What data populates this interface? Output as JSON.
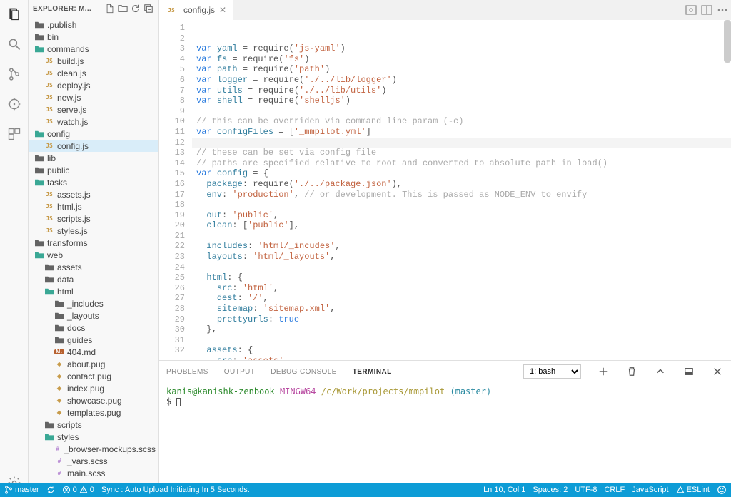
{
  "sidebar": {
    "title": "EXPLORER: M...",
    "tree": [
      {
        "label": ".publish",
        "type": "folder",
        "indent": 0,
        "clr": "grey"
      },
      {
        "label": "bin",
        "type": "folder",
        "indent": 0,
        "clr": "grey"
      },
      {
        "label": "commands",
        "type": "folder",
        "indent": 0,
        "clr": "teal"
      },
      {
        "label": "build.js",
        "type": "js",
        "indent": 1
      },
      {
        "label": "clean.js",
        "type": "js",
        "indent": 1
      },
      {
        "label": "deploy.js",
        "type": "js",
        "indent": 1
      },
      {
        "label": "new.js",
        "type": "js",
        "indent": 1
      },
      {
        "label": "serve.js",
        "type": "js",
        "indent": 1
      },
      {
        "label": "watch.js",
        "type": "js",
        "indent": 1
      },
      {
        "label": "config",
        "type": "folder",
        "indent": 0,
        "clr": "teal"
      },
      {
        "label": "config.js",
        "type": "js",
        "indent": 1,
        "selected": true
      },
      {
        "label": "lib",
        "type": "folder",
        "indent": 0,
        "clr": "grey"
      },
      {
        "label": "public",
        "type": "folder",
        "indent": 0,
        "clr": "grey"
      },
      {
        "label": "tasks",
        "type": "folder",
        "indent": 0,
        "clr": "teal"
      },
      {
        "label": "assets.js",
        "type": "js",
        "indent": 1
      },
      {
        "label": "html.js",
        "type": "js",
        "indent": 1
      },
      {
        "label": "scripts.js",
        "type": "js",
        "indent": 1
      },
      {
        "label": "styles.js",
        "type": "js",
        "indent": 1
      },
      {
        "label": "transforms",
        "type": "folder",
        "indent": 0,
        "clr": "grey"
      },
      {
        "label": "web",
        "type": "folder",
        "indent": 0,
        "clr": "teal"
      },
      {
        "label": "assets",
        "type": "folder",
        "indent": 1,
        "clr": "grey"
      },
      {
        "label": "data",
        "type": "folder",
        "indent": 1,
        "clr": "grey"
      },
      {
        "label": "html",
        "type": "folder",
        "indent": 1,
        "clr": "teal"
      },
      {
        "label": "_includes",
        "type": "folder",
        "indent": 2,
        "clr": "grey"
      },
      {
        "label": "_layouts",
        "type": "folder",
        "indent": 2,
        "clr": "grey"
      },
      {
        "label": "docs",
        "type": "folder",
        "indent": 2,
        "clr": "grey"
      },
      {
        "label": "guides",
        "type": "folder",
        "indent": 2,
        "clr": "grey"
      },
      {
        "label": "404.md",
        "type": "md",
        "indent": 2
      },
      {
        "label": "about.pug",
        "type": "pug",
        "indent": 2
      },
      {
        "label": "contact.pug",
        "type": "pug",
        "indent": 2
      },
      {
        "label": "index.pug",
        "type": "pug",
        "indent": 2
      },
      {
        "label": "showcase.pug",
        "type": "pug",
        "indent": 2
      },
      {
        "label": "templates.pug",
        "type": "pug",
        "indent": 2
      },
      {
        "label": "scripts",
        "type": "folder",
        "indent": 1,
        "clr": "grey"
      },
      {
        "label": "styles",
        "type": "folder",
        "indent": 1,
        "clr": "teal"
      },
      {
        "label": "_browser-mockups.scss",
        "type": "scss",
        "indent": 2
      },
      {
        "label": "_vars.scss",
        "type": "scss",
        "indent": 2
      },
      {
        "label": "main.scss",
        "type": "scss",
        "indent": 2
      }
    ]
  },
  "tab": {
    "label": "config.js"
  },
  "editor": {
    "currentLine": 10,
    "lines": [
      {
        "n": 1,
        "t": "var",
        "frags": [
          [
            "kw",
            "var "
          ],
          [
            "ident",
            "yaml"
          ],
          [
            "punc",
            " = require("
          ],
          [
            "str",
            "'js-yaml'"
          ],
          [
            "punc",
            ")"
          ]
        ]
      },
      {
        "n": 2,
        "t": "var",
        "frags": [
          [
            "kw",
            "var "
          ],
          [
            "ident",
            "fs"
          ],
          [
            "punc",
            " = require("
          ],
          [
            "str",
            "'fs'"
          ],
          [
            "punc",
            ")"
          ]
        ]
      },
      {
        "n": 3,
        "t": "var",
        "frags": [
          [
            "kw",
            "var "
          ],
          [
            "ident",
            "path"
          ],
          [
            "punc",
            " = require("
          ],
          [
            "str",
            "'path'"
          ],
          [
            "punc",
            ")"
          ]
        ]
      },
      {
        "n": 4,
        "t": "var",
        "frags": [
          [
            "kw",
            "var "
          ],
          [
            "ident",
            "logger"
          ],
          [
            "punc",
            " = require("
          ],
          [
            "str",
            "'./../lib/logger'"
          ],
          [
            "punc",
            ")"
          ]
        ]
      },
      {
        "n": 5,
        "t": "var",
        "frags": [
          [
            "kw",
            "var "
          ],
          [
            "ident",
            "utils"
          ],
          [
            "punc",
            " = require("
          ],
          [
            "str",
            "'./../lib/utils'"
          ],
          [
            "punc",
            ")"
          ]
        ]
      },
      {
        "n": 6,
        "t": "var",
        "frags": [
          [
            "kw",
            "var "
          ],
          [
            "ident",
            "shell"
          ],
          [
            "punc",
            " = require("
          ],
          [
            "str",
            "'shelljs'"
          ],
          [
            "punc",
            ")"
          ]
        ]
      },
      {
        "n": 7,
        "frags": []
      },
      {
        "n": 8,
        "frags": [
          [
            "cmt",
            "// this can be overriden via command line param (-c)"
          ]
        ]
      },
      {
        "n": 9,
        "frags": [
          [
            "kw",
            "var "
          ],
          [
            "ident",
            "configFiles"
          ],
          [
            "punc",
            " = ["
          ],
          [
            "str",
            "'_mmpilot.yml'"
          ],
          [
            "punc",
            "]"
          ]
        ]
      },
      {
        "n": 10,
        "frags": []
      },
      {
        "n": 11,
        "frags": [
          [
            "cmt",
            "// these can be set via config file"
          ]
        ]
      },
      {
        "n": 12,
        "frags": [
          [
            "cmt",
            "// paths are specified relative to root and converted to absolute path in load()"
          ]
        ]
      },
      {
        "n": 13,
        "frags": [
          [
            "kw",
            "var "
          ],
          [
            "ident",
            "config"
          ],
          [
            "punc",
            " = {"
          ]
        ]
      },
      {
        "n": 14,
        "frags": [
          [
            "punc",
            "  "
          ],
          [
            "prop",
            "package"
          ],
          [
            "punc",
            ": require("
          ],
          [
            "str",
            "'./../package.json'"
          ],
          [
            "punc",
            "),"
          ]
        ]
      },
      {
        "n": 15,
        "frags": [
          [
            "punc",
            "  "
          ],
          [
            "prop",
            "env"
          ],
          [
            "punc",
            ": "
          ],
          [
            "str",
            "'production'"
          ],
          [
            "punc",
            ", "
          ],
          [
            "cmt",
            "// or development. This is passed as NODE_ENV to envify"
          ]
        ]
      },
      {
        "n": 16,
        "frags": []
      },
      {
        "n": 17,
        "frags": [
          [
            "punc",
            "  "
          ],
          [
            "prop",
            "out"
          ],
          [
            "punc",
            ": "
          ],
          [
            "str",
            "'public'"
          ],
          [
            "punc",
            ","
          ]
        ]
      },
      {
        "n": 18,
        "frags": [
          [
            "punc",
            "  "
          ],
          [
            "prop",
            "clean"
          ],
          [
            "punc",
            ": ["
          ],
          [
            "str",
            "'public'"
          ],
          [
            "punc",
            "],"
          ]
        ]
      },
      {
        "n": 19,
        "frags": []
      },
      {
        "n": 20,
        "frags": [
          [
            "punc",
            "  "
          ],
          [
            "prop",
            "includes"
          ],
          [
            "punc",
            ": "
          ],
          [
            "str",
            "'html/_incudes'"
          ],
          [
            "punc",
            ","
          ]
        ]
      },
      {
        "n": 21,
        "frags": [
          [
            "punc",
            "  "
          ],
          [
            "prop",
            "layouts"
          ],
          [
            "punc",
            ": "
          ],
          [
            "str",
            "'html/_layouts'"
          ],
          [
            "punc",
            ","
          ]
        ]
      },
      {
        "n": 22,
        "frags": []
      },
      {
        "n": 23,
        "frags": [
          [
            "punc",
            "  "
          ],
          [
            "prop",
            "html"
          ],
          [
            "punc",
            ": {"
          ]
        ]
      },
      {
        "n": 24,
        "frags": [
          [
            "punc",
            "    "
          ],
          [
            "prop",
            "src"
          ],
          [
            "punc",
            ": "
          ],
          [
            "str",
            "'html'"
          ],
          [
            "punc",
            ","
          ]
        ]
      },
      {
        "n": 25,
        "frags": [
          [
            "punc",
            "    "
          ],
          [
            "prop",
            "dest"
          ],
          [
            "punc",
            ": "
          ],
          [
            "str",
            "'/'"
          ],
          [
            "punc",
            ","
          ]
        ]
      },
      {
        "n": 26,
        "frags": [
          [
            "punc",
            "    "
          ],
          [
            "prop",
            "sitemap"
          ],
          [
            "punc",
            ": "
          ],
          [
            "str",
            "'sitemap.xml'"
          ],
          [
            "punc",
            ","
          ]
        ]
      },
      {
        "n": 27,
        "frags": [
          [
            "punc",
            "    "
          ],
          [
            "prop",
            "prettyurls"
          ],
          [
            "punc",
            ": "
          ],
          [
            "bool",
            "true"
          ]
        ]
      },
      {
        "n": 28,
        "frags": [
          [
            "punc",
            "  },"
          ]
        ]
      },
      {
        "n": 29,
        "frags": []
      },
      {
        "n": 30,
        "frags": [
          [
            "punc",
            "  "
          ],
          [
            "prop",
            "assets"
          ],
          [
            "punc",
            ": {"
          ]
        ]
      },
      {
        "n": 31,
        "frags": [
          [
            "punc",
            "    "
          ],
          [
            "prop",
            "src"
          ],
          [
            "punc",
            ": "
          ],
          [
            "str",
            "'assets'"
          ],
          [
            "punc",
            ","
          ]
        ]
      },
      {
        "n": 32,
        "frags": [
          [
            "punc",
            "    "
          ],
          [
            "prop",
            "dest"
          ],
          [
            "punc",
            ": "
          ],
          [
            "str",
            "'/'"
          ]
        ]
      }
    ]
  },
  "panel": {
    "tabs": [
      "PROBLEMS",
      "OUTPUT",
      "DEBUG CONSOLE",
      "TERMINAL"
    ],
    "activeTab": "TERMINAL",
    "select": "1: bash",
    "terminal": {
      "userhost": "kanis@kanishk-zenbook ",
      "mingw": "MINGW64 ",
      "path": "/c/Work/projects/mmpilot ",
      "branch": "(master)",
      "prompt": "$ "
    }
  },
  "status": {
    "branch": "master",
    "errors": "0",
    "warnings": "0",
    "sync": "Sync : Auto Upload Initiating In 5 Seconds.",
    "pos": "Ln 10, Col 1",
    "spaces": "Spaces: 2",
    "encoding": "UTF-8",
    "eol": "CRLF",
    "lang": "JavaScript",
    "eslint": "ESLint"
  }
}
